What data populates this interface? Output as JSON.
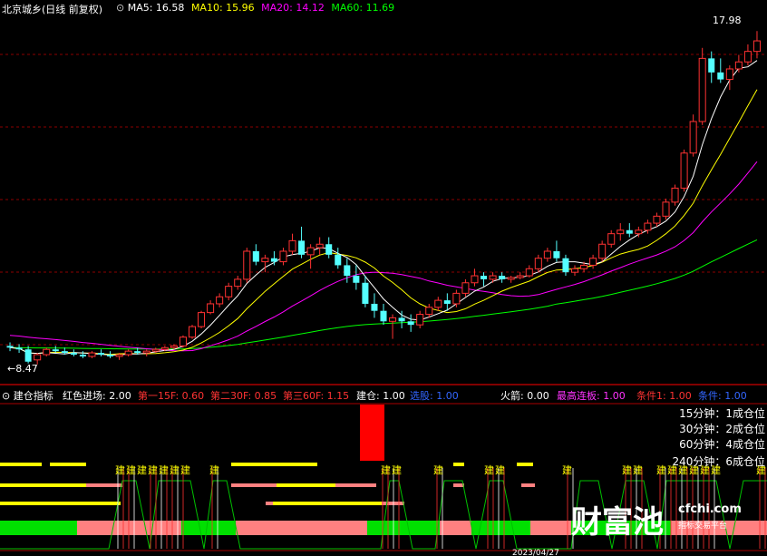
{
  "header": {
    "stock_name": "北京城乡(日线 前复权)",
    "ma5": {
      "label": "MA5: 16.58",
      "color": "#ffffff"
    },
    "ma10": {
      "label": "MA10: 15.96",
      "color": "#ffff00"
    },
    "ma20": {
      "label": "MA20: 14.12",
      "color": "#ff00ff"
    },
    "ma60": {
      "label": "MA60: 11.69",
      "color": "#00ff00"
    }
  },
  "price_labels": {
    "high": "17.98",
    "low": "←8.47"
  },
  "indicator_header": {
    "name": "建仓指标",
    "items": [
      {
        "text": "红色进场: 2.00",
        "color": "#ffffff"
      },
      {
        "text": "第一15F: 0.60",
        "color": "#ff3333"
      },
      {
        "text": "第二30F: 0.85",
        "color": "#ff3333"
      },
      {
        "text": "第三60F: 1.15",
        "color": "#ff3333"
      },
      {
        "text": "建仓: 1.00",
        "color": "#ffffff"
      },
      {
        "text": "选股: 1.00",
        "color": "#3366ff"
      },
      {
        "text": "火箭: 0.00",
        "color": "#ffffff"
      },
      {
        "text": "最高连板: 1.00",
        "color": "#ff33ff"
      },
      {
        "text": "条件1: 1.00",
        "color": "#ff3333"
      },
      {
        "text": "条件: 1.00",
        "color": "#3366ff"
      }
    ]
  },
  "position_labels": [
    "15分钟：1成仓位",
    "30分钟：2成仓位",
    "60分钟：4成仓位",
    "240分钟：6成仓位"
  ],
  "signal_text": "建",
  "date_label": "2023/04/27",
  "watermark": {
    "main": "财富池",
    "domain": "cfchi.com",
    "sub": "指标交易平台"
  },
  "colors": {
    "up": "#ff3232",
    "down": "#54ffff",
    "entry_bar": "#ff0000",
    "band_green": "#00e000",
    "band_pink": "#ff8080",
    "signal": "#ffff00"
  },
  "chart_data": {
    "type": "candlestick",
    "ylim": [
      8.0,
      18.4
    ],
    "ohlc": [
      [
        9.0,
        9.1,
        8.85,
        8.95
      ],
      [
        8.95,
        9.05,
        8.8,
        8.9
      ],
      [
        8.9,
        9.0,
        8.5,
        8.55
      ],
      [
        8.6,
        8.8,
        8.47,
        8.75
      ],
      [
        8.75,
        8.95,
        8.7,
        8.9
      ],
      [
        8.9,
        9.0,
        8.8,
        8.85
      ],
      [
        8.85,
        8.95,
        8.75,
        8.8
      ],
      [
        8.8,
        8.9,
        8.7,
        8.75
      ],
      [
        8.75,
        8.85,
        8.65,
        8.7
      ],
      [
        8.7,
        8.85,
        8.65,
        8.8
      ],
      [
        8.8,
        8.9,
        8.7,
        8.75
      ],
      [
        8.75,
        8.85,
        8.65,
        8.7
      ],
      [
        8.7,
        8.8,
        8.6,
        8.75
      ],
      [
        8.75,
        8.9,
        8.7,
        8.85
      ],
      [
        8.85,
        8.95,
        8.75,
        8.8
      ],
      [
        8.8,
        8.9,
        8.7,
        8.85
      ],
      [
        8.85,
        8.95,
        8.8,
        8.9
      ],
      [
        8.9,
        9.0,
        8.85,
        8.95
      ],
      [
        8.95,
        9.05,
        8.9,
        9.0
      ],
      [
        9.0,
        9.3,
        8.95,
        9.25
      ],
      [
        9.25,
        9.6,
        9.2,
        9.55
      ],
      [
        9.55,
        10.0,
        9.5,
        9.95
      ],
      [
        9.95,
        10.3,
        9.9,
        10.2
      ],
      [
        10.2,
        10.5,
        10.1,
        10.4
      ],
      [
        10.4,
        10.8,
        10.3,
        10.7
      ],
      [
        10.7,
        11.0,
        10.6,
        10.9
      ],
      [
        10.9,
        11.8,
        10.8,
        11.7
      ],
      [
        11.7,
        11.9,
        11.3,
        11.4
      ],
      [
        11.4,
        11.6,
        11.1,
        11.5
      ],
      [
        11.5,
        11.7,
        11.3,
        11.4
      ],
      [
        11.4,
        11.8,
        11.3,
        11.7
      ],
      [
        11.7,
        12.2,
        11.6,
        12.0
      ],
      [
        12.0,
        12.4,
        11.5,
        11.6
      ],
      [
        11.6,
        11.9,
        11.2,
        11.8
      ],
      [
        11.8,
        12.1,
        11.6,
        11.9
      ],
      [
        11.9,
        12.1,
        11.5,
        11.6
      ],
      [
        11.6,
        11.8,
        11.2,
        11.3
      ],
      [
        11.3,
        11.5,
        10.8,
        11.0
      ],
      [
        11.0,
        11.3,
        10.6,
        10.8
      ],
      [
        10.8,
        11.0,
        10.1,
        10.2
      ],
      [
        10.2,
        10.5,
        9.8,
        10.0
      ],
      [
        10.0,
        10.2,
        9.6,
        9.7
      ],
      [
        9.7,
        9.9,
        9.2,
        9.8
      ],
      [
        9.8,
        10.0,
        9.5,
        9.7
      ],
      [
        9.7,
        9.9,
        9.4,
        9.6
      ],
      [
        9.6,
        10.0,
        9.5,
        9.9
      ],
      [
        9.9,
        10.2,
        9.8,
        10.1
      ],
      [
        10.1,
        10.4,
        10.0,
        10.3
      ],
      [
        10.3,
        10.5,
        10.0,
        10.2
      ],
      [
        10.2,
        10.6,
        10.1,
        10.5
      ],
      [
        10.5,
        10.9,
        10.4,
        10.8
      ],
      [
        10.8,
        11.2,
        10.7,
        11.0
      ],
      [
        11.0,
        11.1,
        10.7,
        10.9
      ],
      [
        10.9,
        11.1,
        10.8,
        11.0
      ],
      [
        11.0,
        11.1,
        10.8,
        10.9
      ],
      [
        10.9,
        11.0,
        10.8,
        10.95
      ],
      [
        10.95,
        11.1,
        10.9,
        11.0
      ],
      [
        11.0,
        11.3,
        10.95,
        11.2
      ],
      [
        11.2,
        11.6,
        11.1,
        11.5
      ],
      [
        11.5,
        11.8,
        11.4,
        11.7
      ],
      [
        11.7,
        12.0,
        11.4,
        11.5
      ],
      [
        11.5,
        11.6,
        11.0,
        11.1
      ],
      [
        11.1,
        11.3,
        11.0,
        11.2
      ],
      [
        11.2,
        11.4,
        11.1,
        11.3
      ],
      [
        11.3,
        11.6,
        11.2,
        11.5
      ],
      [
        11.5,
        12.0,
        11.4,
        11.9
      ],
      [
        11.9,
        12.3,
        11.8,
        12.2
      ],
      [
        12.2,
        12.5,
        12.0,
        12.3
      ],
      [
        12.3,
        12.5,
        12.1,
        12.2
      ],
      [
        12.2,
        12.4,
        12.1,
        12.3
      ],
      [
        12.3,
        12.6,
        12.2,
        12.5
      ],
      [
        12.5,
        12.8,
        12.4,
        12.7
      ],
      [
        12.7,
        13.2,
        12.6,
        13.1
      ],
      [
        13.1,
        13.6,
        13.0,
        13.5
      ],
      [
        13.5,
        14.6,
        13.4,
        14.5
      ],
      [
        14.5,
        15.6,
        14.4,
        15.4
      ],
      [
        15.4,
        17.5,
        15.3,
        17.2
      ],
      [
        17.2,
        17.4,
        16.5,
        16.8
      ],
      [
        16.8,
        17.2,
        16.5,
        16.6
      ],
      [
        16.6,
        17.0,
        16.3,
        16.9
      ],
      [
        16.9,
        17.3,
        16.8,
        17.1
      ],
      [
        17.1,
        17.6,
        17.0,
        17.4
      ],
      [
        17.4,
        17.98,
        17.2,
        17.7
      ]
    ]
  }
}
